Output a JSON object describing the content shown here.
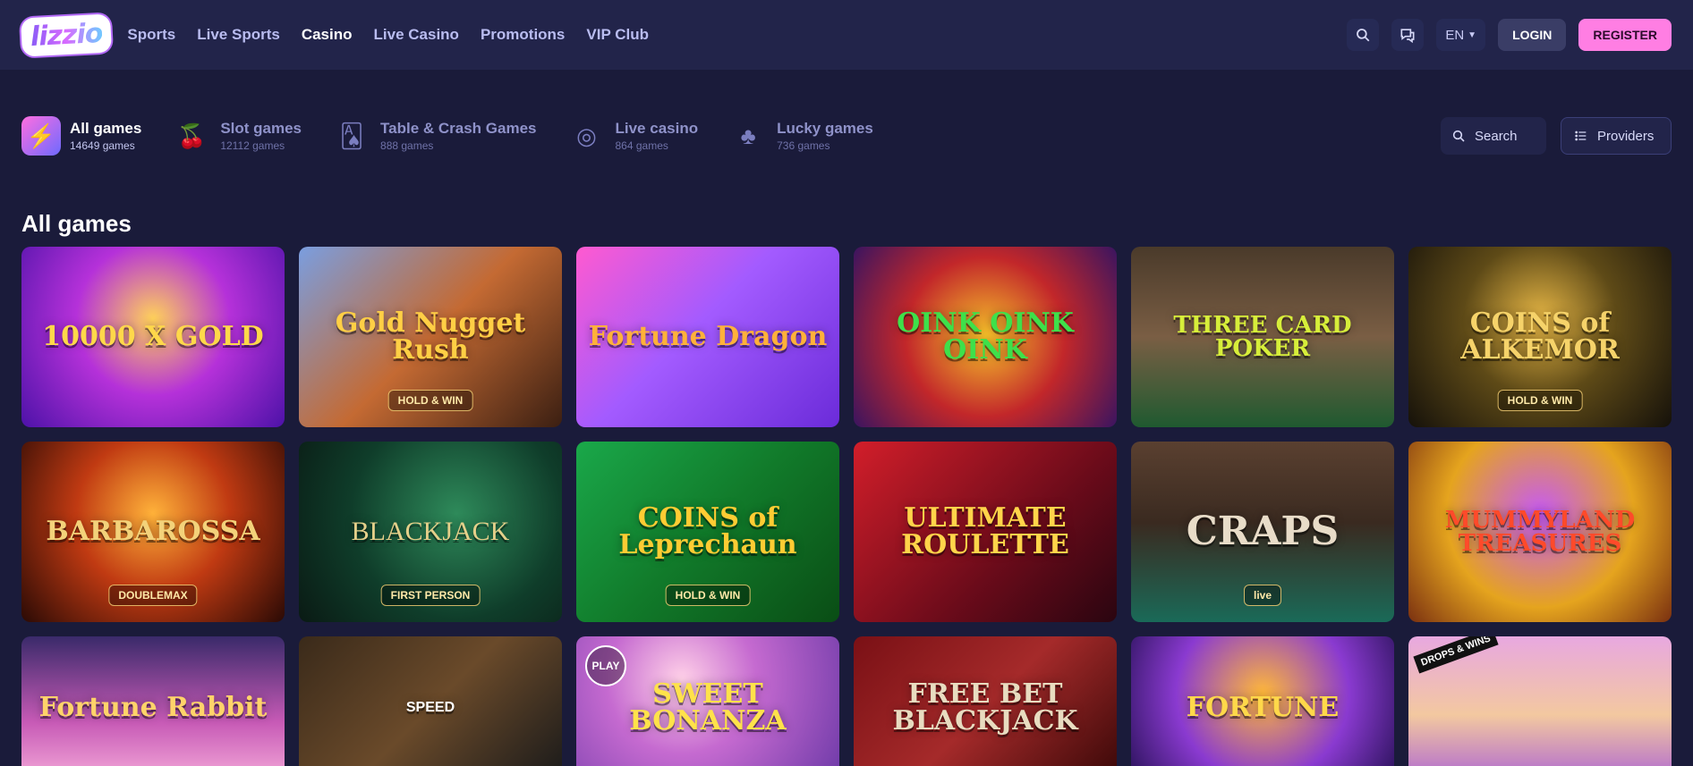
{
  "header": {
    "logo_text": "lizzio",
    "nav": [
      {
        "label": "Sports"
      },
      {
        "label": "Live Sports"
      },
      {
        "label": "Casino"
      },
      {
        "label": "Live Casino"
      },
      {
        "label": "Promotions"
      },
      {
        "label": "VIP Club"
      }
    ],
    "active_nav": "Casino",
    "lang": "EN",
    "login_label": "LOGIN",
    "register_label": "REGISTER"
  },
  "categories": [
    {
      "name": "All games",
      "count": "14649 games",
      "icon": "lightning-icon"
    },
    {
      "name": "Slot games",
      "count": "12112 games",
      "icon": "cherries-icon"
    },
    {
      "name": "Table & Crash Games",
      "count": "888 games",
      "icon": "cards-icon"
    },
    {
      "name": "Live casino",
      "count": "864 games",
      "icon": "roulette-icon"
    },
    {
      "name": "Lucky games",
      "count": "736 games",
      "icon": "clover-icon"
    }
  ],
  "toolbar": {
    "search_label": "Search",
    "providers_label": "Providers"
  },
  "section_title": "All games",
  "games": [
    {
      "title": "10000 X GOLD",
      "sub": ""
    },
    {
      "title": "Gold Nugget Rush",
      "sub": "HOLD & WIN"
    },
    {
      "title": "Fortune Dragon",
      "sub": ""
    },
    {
      "title": "OINK OINK OINK",
      "sub": ""
    },
    {
      "title": "THREE CARD POKER",
      "sub": ""
    },
    {
      "title": "COINS of ALKEMOR",
      "sub": "HOLD & WIN"
    },
    {
      "title": "BARBAROSSA",
      "sub": "DOUBLEMAX"
    },
    {
      "title": "BLACKJACK",
      "sub": "FIRST PERSON"
    },
    {
      "title": "COINS of Leprechaun",
      "sub": "HOLD & WIN"
    },
    {
      "title": "ULTIMATE ROULETTE",
      "sub": ""
    },
    {
      "title": "CRAPS",
      "sub": "live"
    },
    {
      "title": "MUMMYLAND TREASURES",
      "sub": ""
    },
    {
      "title": "Fortune Rabbit",
      "sub": ""
    },
    {
      "title": "SPEED",
      "sub": ""
    },
    {
      "title": "SWEET BONANZA",
      "sub": ""
    },
    {
      "title": "FREE BET BLACKJACK",
      "sub": ""
    },
    {
      "title": "FORTUNE",
      "sub": ""
    },
    {
      "title": "",
      "sub": ""
    }
  ],
  "badges": {
    "play": "PLAY",
    "drops": "DROPS & WINS"
  },
  "colors": {
    "background": "#1a1b3a",
    "header": "#22244a",
    "register": "#ff7ee3"
  }
}
